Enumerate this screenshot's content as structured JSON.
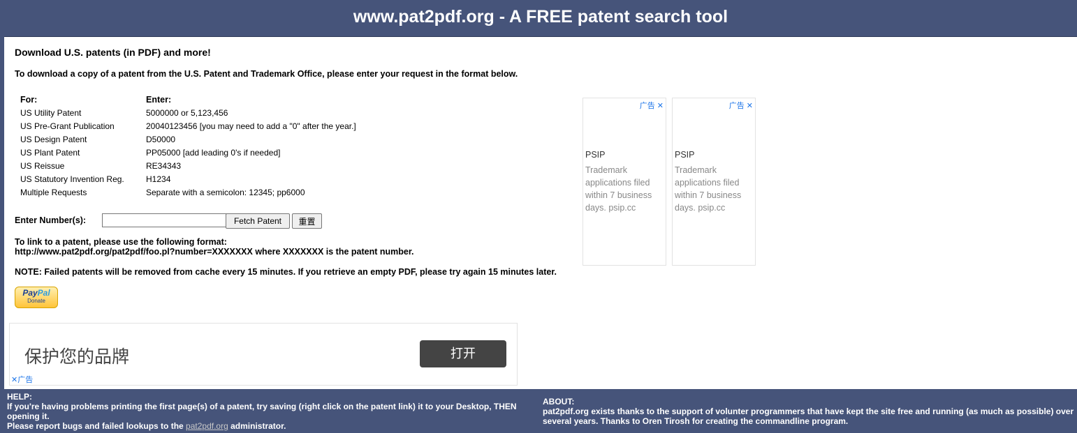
{
  "header": {
    "title": "www.pat2pdf.org - A FREE patent search tool"
  },
  "intro": {
    "title": "Download U.S. patents (in PDF) and more!",
    "text": "To download a copy of a patent from the U.S. Patent and Trademark Office, please enter your request in the format below."
  },
  "formats": {
    "col_for": "For:",
    "col_enter": "Enter:",
    "rows": [
      {
        "for": "US Utility Patent",
        "enter": "5000000 or 5,123,456"
      },
      {
        "for": "US Pre-Grant Publication",
        "enter": "20040123456 [you may need to add a \"0\" after the year.]"
      },
      {
        "for": "US Design Patent",
        "enter": "D50000"
      },
      {
        "for": "US Plant Patent",
        "enter": "PP05000 [add leading 0's if needed]"
      },
      {
        "for": "US Reissue",
        "enter": "RE34343"
      },
      {
        "for": "US Statutory Invention Reg.",
        "enter": "H1234"
      },
      {
        "for": "Multiple Requests",
        "enter": "Separate with a semicolon: 12345; pp6000"
      }
    ]
  },
  "form": {
    "label": "Enter Number(s):",
    "input_value": "",
    "fetch_label": "Fetch Patent",
    "reset_label": "重置"
  },
  "link_info": {
    "line1": "To link to a patent, please use the following format:",
    "line2": "http://www.pat2pdf.org/pat2pdf/foo.pl?number=XXXXXXX where XXXXXXX is the patent number."
  },
  "note": "NOTE: Failed patents will be removed from cache every 15 minutes. If you retrieve an empty PDF, please try again 15 minutes later.",
  "paypal": {
    "logo_pay": "Pay",
    "logo_pal": "Pal",
    "donate": "Donate"
  },
  "side_ads": [
    {
      "tag": "广告",
      "title": "PSIP",
      "body": "Trademark applications filed within 7 business days. psip.cc"
    },
    {
      "tag": "广告",
      "title": "PSIP",
      "body": "Trademark applications filed within 7 business days. psip.cc"
    }
  ],
  "bottom_ad": {
    "text": "保护您的品牌",
    "button": "打开",
    "tag": "广告"
  },
  "footer": {
    "help_heading": "HELP:",
    "help_line1": "If you're having problems printing the first page(s) of a patent, try saving (right click on the patent link) it to your Desktop, THEN opening it.",
    "help_line2_pre": "Please report bugs and failed lookups to the ",
    "help_link": "pat2pdf.org",
    "help_line2_post": " administrator.",
    "about_heading": "ABOUT:",
    "about_text": "pat2pdf.org exists thanks to the support of volunter programmers that have kept the site free and running (as much as possible) over several years. Thanks to Oren Tirosh for creating the commandline program."
  },
  "colors": {
    "frame": "#46547a",
    "ad_link": "#1a73e8",
    "open_button": "#444444"
  }
}
